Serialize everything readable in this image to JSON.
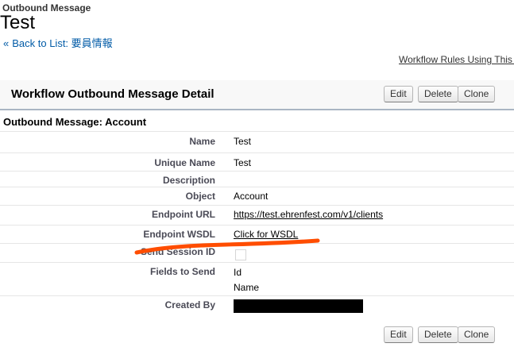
{
  "header": {
    "breadcrumb_type": "Outbound Message",
    "title": "Test",
    "back_arrow": "«",
    "back_link": "Back to List: 要員情報",
    "related_link": "Workflow Rules Using This Outbound Message"
  },
  "detail": {
    "section_title": "Workflow Outbound Message Detail",
    "buttons": {
      "edit": "Edit",
      "delete": "Delete",
      "clone": "Clone"
    },
    "object_subheader": "Outbound Message: Account",
    "fields": {
      "name": {
        "label": "Name",
        "value": "Test"
      },
      "unique_name": {
        "label": "Unique Name",
        "value": "Test"
      },
      "description": {
        "label": "Description",
        "value": ""
      },
      "object": {
        "label": "Object",
        "value": "Account"
      },
      "endpoint_url": {
        "label": "Endpoint URL",
        "value": "https://test.ehrenfest.com/v1/clients"
      },
      "endpoint_wsdl": {
        "label": "Endpoint WSDL",
        "value": "Click for WSDL"
      },
      "send_session_id": {
        "label": "Send Session ID",
        "checked": false
      },
      "fields_to_send": {
        "label": "Fields to Send",
        "values": [
          "Id",
          "Name"
        ]
      },
      "created_by": {
        "label": "Created By"
      }
    }
  },
  "annotation": {
    "color": "#ff4d00"
  }
}
